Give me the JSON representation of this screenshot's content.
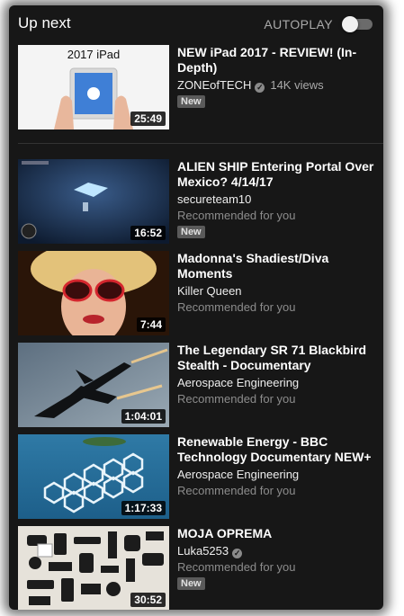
{
  "header": {
    "title": "Up next",
    "autoplay_label": "AUTOPLAY",
    "autoplay_on": false
  },
  "videos": [
    {
      "title": "NEW iPad 2017 - REVIEW! (In-Depth)",
      "channel": "ZONEofTECH",
      "verified": true,
      "views": "14K views",
      "meta": "",
      "badge": "New",
      "duration": "25:49",
      "thumb_text": "2017 iPad"
    },
    {
      "title": "ALIEN SHIP Entering Portal Over Mexico? 4/14/17",
      "channel": "secureteam10",
      "verified": false,
      "views": "",
      "meta": "Recommended for you",
      "badge": "New",
      "duration": "16:52"
    },
    {
      "title": "Madonna's Shadiest/Diva Moments",
      "channel": "Killer Queen",
      "verified": false,
      "views": "",
      "meta": "Recommended for you",
      "badge": "",
      "duration": "7:44"
    },
    {
      "title": "The Legendary SR 71 Blackbird Stealth - Documentary",
      "channel": "Aerospace Engineering",
      "verified": false,
      "views": "",
      "meta": "Recommended for you",
      "badge": "",
      "duration": "1:04:01"
    },
    {
      "title": "Renewable Energy - BBC Technology Documentary NEW+",
      "channel": "Aerospace Engineering",
      "verified": false,
      "views": "",
      "meta": "Recommended for you",
      "badge": "",
      "duration": "1:17:33"
    },
    {
      "title": "MOJA OPREMA",
      "channel": "Luka5253",
      "verified": true,
      "views": "",
      "meta": "Recommended for you",
      "badge": "New",
      "duration": "30:52"
    }
  ]
}
